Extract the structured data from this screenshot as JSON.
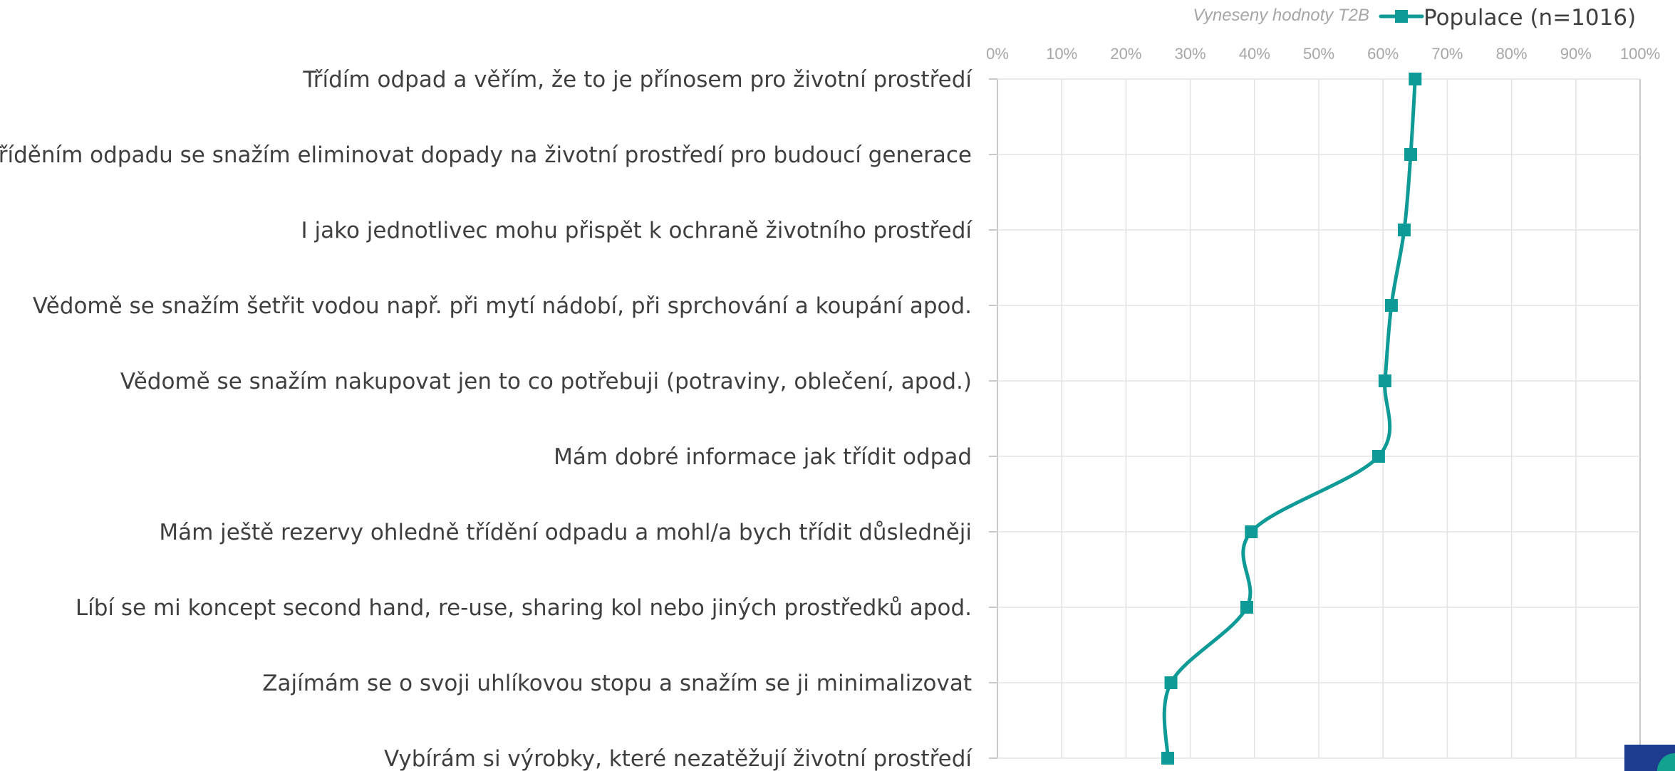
{
  "chart_data": {
    "type": "line",
    "orientation": "horizontal",
    "note": "Vyneseny hodnoty T2B",
    "categories": [
      "Třídím odpad a věřím, že to je přínosem pro životní prostředí",
      "Tříděním odpadu se snažím eliminovat dopady na životní prostředí pro budoucí generace",
      "I jako jednotlivec mohu přispět k ochraně životního prostředí",
      "Vědomě se snažím šetřit vodou např. při mytí nádobí, při sprchování a koupání apod.",
      "Vědomě se snažím nakupovat jen to co potřebuji (potraviny, oblečení, apod.)",
      "Mám dobré informace jak třídit odpad",
      "Mám ještě rezervy ohledně třídění odpadu a mohl/a bych třídit důsledněji",
      "Líbí se mi koncept second hand, re-use, sharing kol nebo jiných prostředků apod.",
      "Zajímám se o svoji uhlíkovou stopu a snažím se ji minimalizovat",
      "Vybírám si výrobky, které nezatěžují životní prostředí"
    ],
    "series": [
      {
        "name": "Populace (n=1016)",
        "color": "#0e9a96",
        "values": [
          65,
          64.3,
          63.3,
          61.3,
          60.3,
          59.3,
          39.5,
          38.8,
          27,
          26.5
        ]
      }
    ],
    "x_ticks": [
      "0%",
      "10%",
      "20%",
      "30%",
      "40%",
      "50%",
      "60%",
      "70%",
      "80%",
      "90%",
      "100%"
    ],
    "xlim": [
      0,
      100
    ],
    "x_axis_position": "top",
    "grid": true,
    "legend": "top-right",
    "marker": "square",
    "smooth": true
  }
}
